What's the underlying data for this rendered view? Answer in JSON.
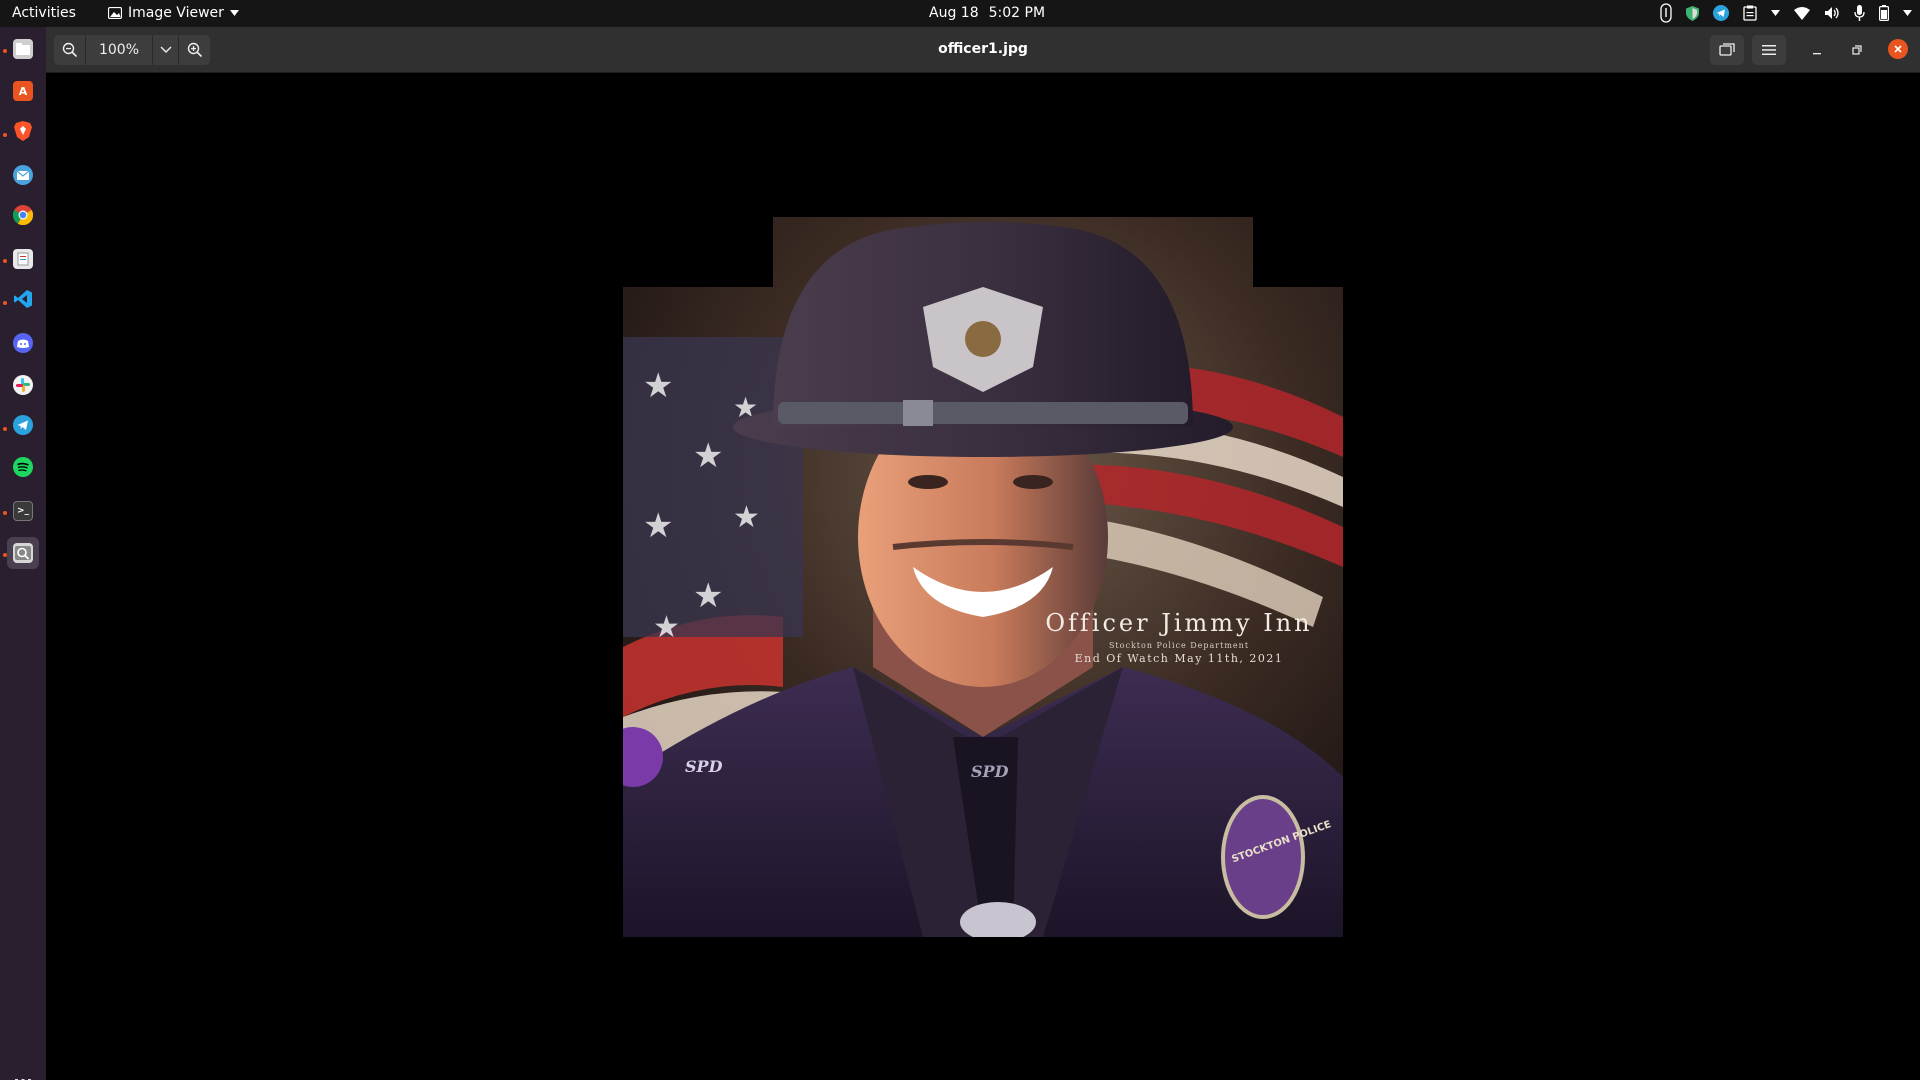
{
  "topbar": {
    "activities": "Activities",
    "app_name": "Image Viewer",
    "date": "Aug 18",
    "time": "5:02 PM"
  },
  "dock": {
    "items": [
      {
        "name": "files",
        "color": "#cfcfcf",
        "glyph": ""
      },
      {
        "name": "app-center",
        "color": "#e95420",
        "glyph": "A"
      },
      {
        "name": "brave",
        "color": "#fb542b",
        "glyph": ""
      },
      {
        "name": "mail",
        "color": "#4aa3df",
        "glyph": ""
      },
      {
        "name": "chrome",
        "color": "#fbbc05",
        "glyph": ""
      },
      {
        "name": "document",
        "color": "#e0e0e0",
        "glyph": ""
      },
      {
        "name": "vscode",
        "color": "#22a6f0",
        "glyph": ""
      },
      {
        "name": "discord",
        "color": "#5865f2",
        "glyph": ""
      },
      {
        "name": "slack",
        "color": "#e8e8e8",
        "glyph": ""
      },
      {
        "name": "telegram",
        "color": "#2aa3dd",
        "glyph": ""
      },
      {
        "name": "spotify",
        "color": "#1ed760",
        "glyph": ""
      },
      {
        "name": "terminal",
        "color": "#3a3a3a",
        "glyph": ">_"
      },
      {
        "name": "image-viewer",
        "color": "#cfcfcf",
        "glyph": ""
      }
    ]
  },
  "header": {
    "zoom": "100%",
    "title": "officer1.jpg"
  },
  "photo": {
    "name": "Officer Jimmy Inn",
    "department": "Stockton Police Department",
    "end_of_watch": "End Of Watch May 11th, 2021",
    "badge_shoulder_left": "SPD",
    "badge_shoulder_right": "SPD",
    "patch": "STOCKTON POLICE"
  },
  "colors": {
    "accent": "#e95420",
    "dock_bg": "#2a1f2e",
    "header_bg": "#303030"
  }
}
